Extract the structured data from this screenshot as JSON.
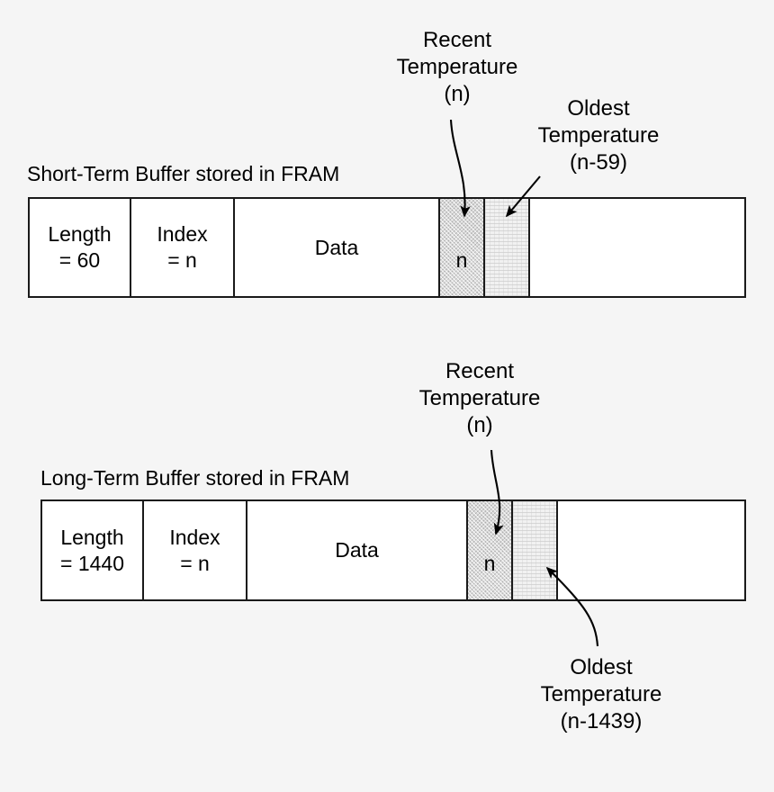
{
  "figure": {
    "background_color": "#f5f5f5",
    "line_color": "#1a1a1a"
  },
  "short_term": {
    "title": "Short-Term Buffer stored in FRAM",
    "fields": {
      "length_label": "Length",
      "length_value": "= 60",
      "index_label": "Index",
      "index_value": "= n",
      "data_label": "Data",
      "recent_cell_value": "n",
      "oldest_cell_value": ""
    },
    "annotations": {
      "recent": {
        "line1": "Recent",
        "line2": "Temperature",
        "line3": "(n)"
      },
      "oldest": {
        "line1": "Oldest",
        "line2": "Temperature",
        "line3": "(n-59)"
      }
    }
  },
  "long_term": {
    "title": "Long-Term Buffer stored in FRAM",
    "fields": {
      "length_label": "Length",
      "length_value": "= 1440",
      "index_label": "Index",
      "index_value": "= n",
      "data_label": "Data",
      "recent_cell_value": "n",
      "oldest_cell_value": ""
    },
    "annotations": {
      "recent": {
        "line1": "Recent",
        "line2": "Temperature",
        "line3": "(n)"
      },
      "oldest": {
        "line1": "Oldest",
        "line2": "Temperature",
        "line3": "(n-1439)"
      }
    }
  }
}
